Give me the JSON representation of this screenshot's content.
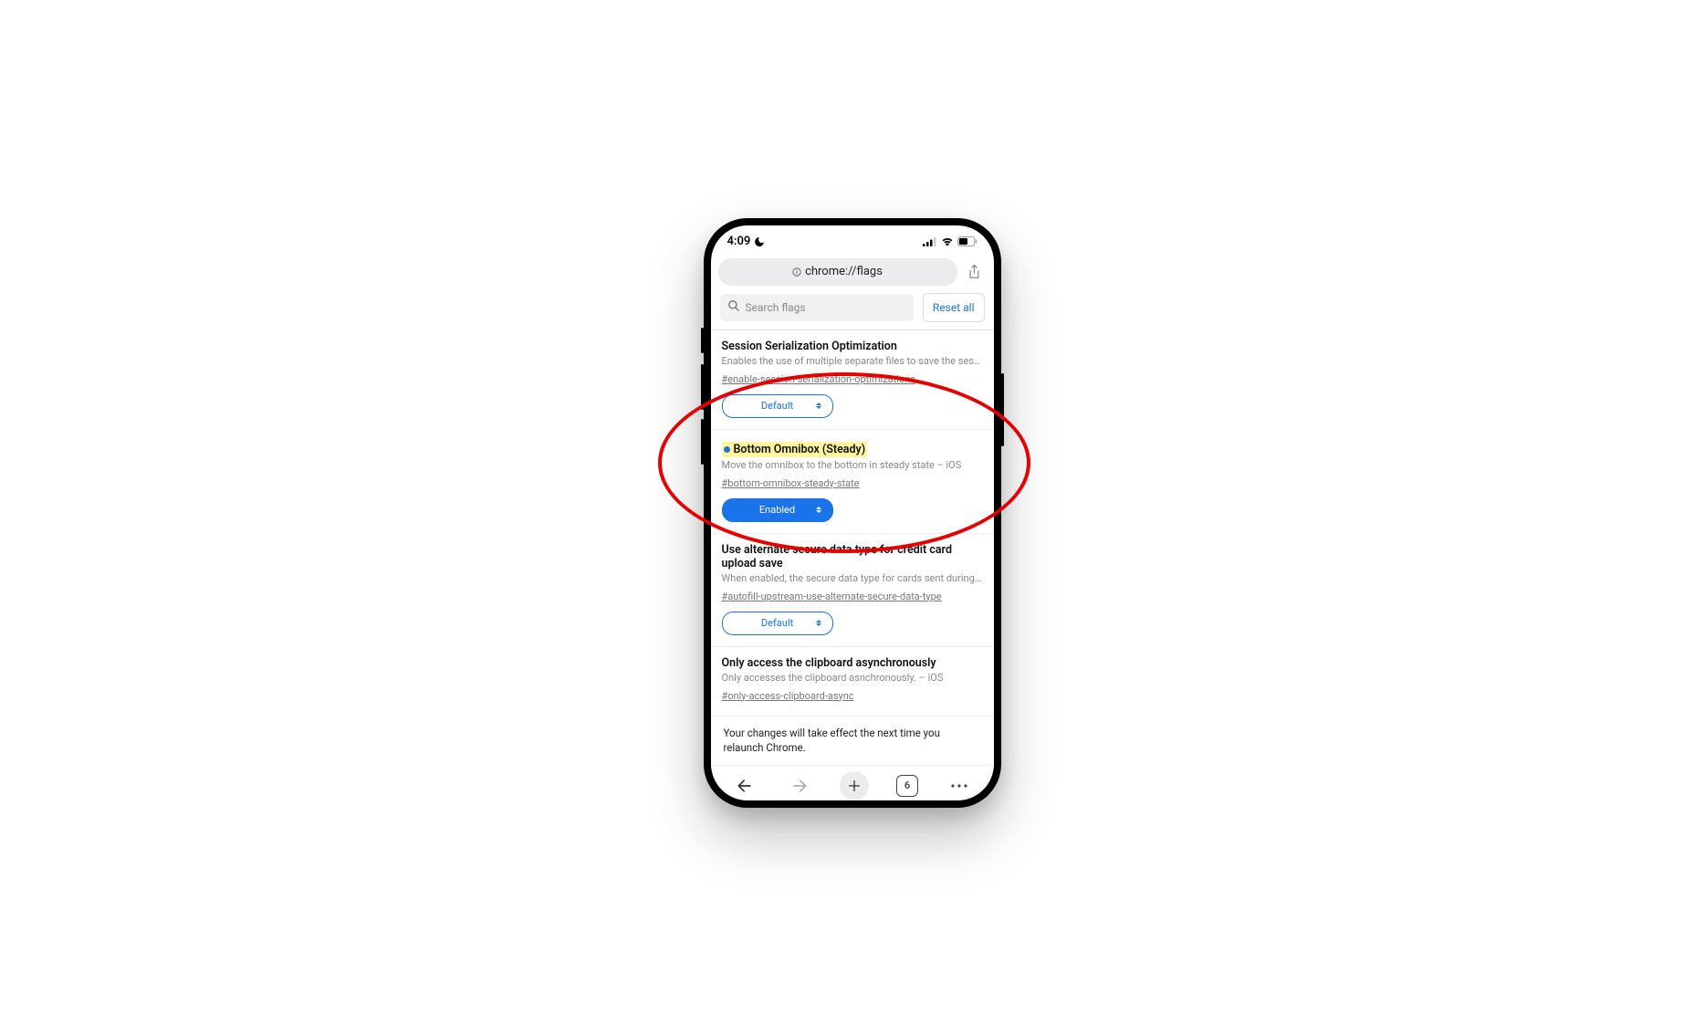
{
  "statusbar": {
    "time": "4:09"
  },
  "urlbar": {
    "url": "chrome://flags"
  },
  "search": {
    "placeholder": "Search flags",
    "reset_label": "Reset all"
  },
  "flags": [
    {
      "title": "Session Serialization Optimization",
      "desc": "Enables the use of multiple separate files to save the sessio…",
      "anchor": "#enable-session-serialization-optimizations",
      "selected": "Default",
      "filled": false,
      "highlighted": false
    },
    {
      "title": "Bottom Omnibox (Steady)",
      "desc": "Move the omnibox to the bottom in steady state – iOS",
      "anchor": "#bottom-omnibox-steady-state",
      "selected": "Enabled",
      "filled": true,
      "highlighted": true
    },
    {
      "title": "Use alternate secure data type for credit card upload save",
      "desc": "When enabled, the secure data type for cards sent during cr…",
      "anchor": "#autofill-upstream-use-alternate-secure-data-type",
      "selected": "Default",
      "filled": false,
      "highlighted": false
    },
    {
      "title": "Only access the clipboard asynchronously",
      "desc": "Only accesses the clipboard asnchronously. – iOS",
      "anchor": "#only-access-clipboard-async",
      "selected": "",
      "filled": false,
      "highlighted": false
    }
  ],
  "relaunch": {
    "text": "Your changes will take effect the next time you relaunch Chrome."
  },
  "toolbar": {
    "tab_count": "6"
  }
}
